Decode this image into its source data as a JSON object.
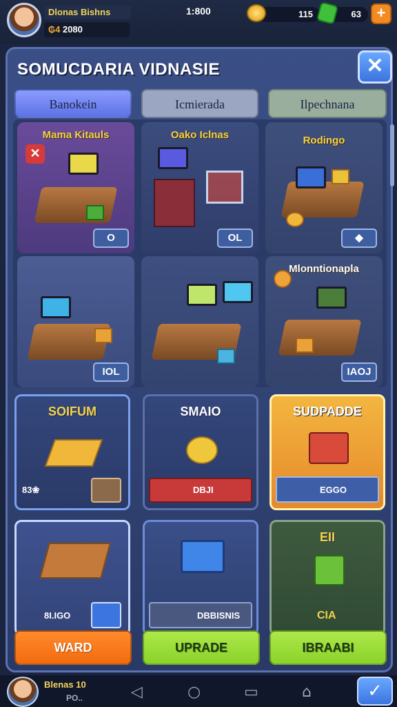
{
  "player": {
    "name": "Dlonas Bishns",
    "level_icon": "₲4",
    "level_text": "2080"
  },
  "timer": "1:800",
  "resources": {
    "coins": "115",
    "gems": "63",
    "plus_label": "+"
  },
  "panel": {
    "title": "SOMUCDARIA VIDNASIE",
    "close_label": "✕"
  },
  "tabs": [
    {
      "label": "Banokein",
      "active": true
    },
    {
      "label": "Icmierada",
      "active": false
    },
    {
      "label": "Ilpechnana",
      "active": false
    }
  ],
  "rooms": [
    {
      "label": "Mama Kitauls",
      "badge": "O",
      "tag": "✕"
    },
    {
      "label": "Oako Iclnas",
      "badge": "OL",
      "tag": ""
    },
    {
      "label": "Rodingo",
      "badge": "◆",
      "tag": ""
    },
    {
      "label": "",
      "badge": "IOL",
      "tag": ""
    },
    {
      "label": "",
      "badge": "",
      "tag": ""
    },
    {
      "label": "Mlonntionapla",
      "badge": "IAOJ",
      "tag": ""
    }
  ],
  "upgrade_cards": [
    {
      "title": "SOIFUM",
      "foot": "83❀"
    },
    {
      "title": "SMAIO",
      "foot": "DBJI"
    },
    {
      "title": "SUDPADDE",
      "foot": "EGGO"
    },
    {
      "title": "",
      "foot": "8I.IGO"
    },
    {
      "title": "",
      "foot": "DBBISNIS"
    },
    {
      "title": "EII",
      "foot": "CIA"
    }
  ],
  "buttons": [
    {
      "label": "WARD"
    },
    {
      "label": "UPRADE"
    },
    {
      "label": "IBRAABI"
    }
  ],
  "navbar": {
    "name": "Blenas 10",
    "sub": "PO.."
  },
  "colors": {
    "orange": "#f36b10",
    "green": "#8ad32a",
    "blue": "#3c74e0",
    "gold": "#f5d24c"
  }
}
